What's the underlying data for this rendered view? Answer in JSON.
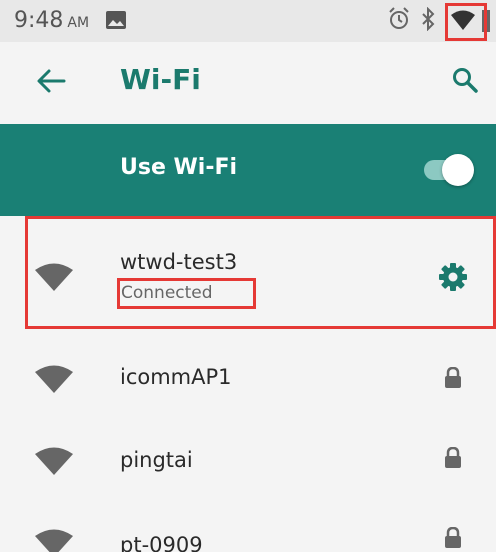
{
  "status_bar": {
    "time": "9:48",
    "ampm": "AM"
  },
  "app_bar": {
    "title": "Wi-Fi"
  },
  "wifi_switch": {
    "label": "Use Wi-Fi",
    "enabled": true
  },
  "connected_network": {
    "ssid": "wtwd-test3",
    "status": "Connected"
  },
  "networks": [
    {
      "ssid": "icommAP1",
      "secured": true
    },
    {
      "ssid": "pingtai",
      "secured": true
    },
    {
      "ssid": "pt-0909",
      "secured": true
    }
  ],
  "colors": {
    "accent": "#1a8075",
    "title_teal": "#1b7a6d",
    "annotation_red": "#e53935",
    "background": "#f4f4f4"
  },
  "icons": [
    "photo-icon",
    "alarm-icon",
    "bluetooth-icon",
    "wifi-status-icon",
    "battery-icon",
    "back-arrow-icon",
    "search-icon",
    "wifi-signal-icon",
    "gear-icon",
    "lock-icon"
  ]
}
